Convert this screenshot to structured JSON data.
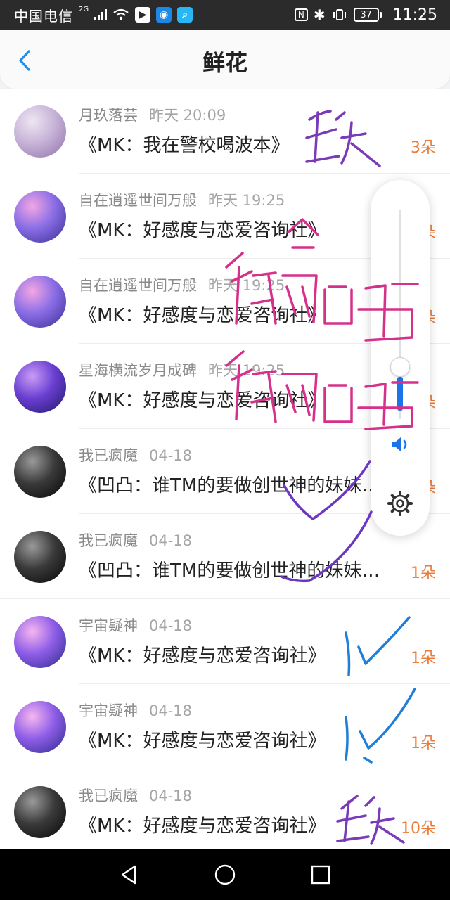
{
  "status_bar": {
    "carrier": "中国电信",
    "network": "2G",
    "battery": "37",
    "time": "11:25"
  },
  "header": {
    "title": "鲜花"
  },
  "rows": [
    {
      "name": "月玖落芸",
      "time": "昨天 20:09",
      "message": "《MK：我在警校喝波本》",
      "count": "3朵",
      "avatar_colors": [
        "#efe6f3",
        "#c7b4d8",
        "#8f6fa8"
      ]
    },
    {
      "name": "自在逍遥世间万般",
      "time": "昨天 19:25",
      "message": "《MK：好感度与恋爱咨询社》",
      "count": "3朵",
      "avatar_colors": [
        "#f3a6e3",
        "#8a6ee6",
        "#3a2d91"
      ]
    },
    {
      "name": "自在逍遥世间万般",
      "time": "昨天 19:25",
      "message": "《MK：好感度与恋爱咨询社》",
      "count": "3朵",
      "avatar_colors": [
        "#f3a6e3",
        "#8a6ee6",
        "#3a2d91"
      ]
    },
    {
      "name": "星海横流岁月成碑",
      "time": "昨天 19:25",
      "message": "《MK：好感度与恋爱咨询社》",
      "count": "3朵",
      "avatar_colors": [
        "#c99cf7",
        "#6a3fd1",
        "#1f1766"
      ]
    },
    {
      "name": "我已疯魔",
      "time": "04-18",
      "message": "《凹凸：谁TM的要做创世神的妹妹…",
      "count": "1朵",
      "avatar_colors": [
        "#9a9a9a",
        "#3a3a3a",
        "#050505"
      ]
    },
    {
      "name": "我已疯魔",
      "time": "04-18",
      "message": "《凹凸：谁TM的要做创世神的妹妹…",
      "count": "1朵",
      "avatar_colors": [
        "#9a9a9a",
        "#3a3a3a",
        "#050505"
      ]
    },
    {
      "name": "宇宙疑神",
      "time": "04-18",
      "message": "《MK：好感度与恋爱咨询社》",
      "count": "1朵",
      "avatar_colors": [
        "#f6b6ef",
        "#8f5ee8",
        "#2a2a8a"
      ]
    },
    {
      "name": "宇宙疑神",
      "time": "04-18",
      "message": "《MK：好感度与恋爱咨询社》",
      "count": "1朵",
      "avatar_colors": [
        "#f6b6ef",
        "#8f5ee8",
        "#2a2a8a"
      ]
    },
    {
      "name": "我已疯魔",
      "time": "04-18",
      "message": "《MK：好感度与恋爱咨询社》",
      "count": "10朵",
      "avatar_colors": [
        "#9a9a9a",
        "#3a3a3a",
        "#050505"
      ]
    }
  ],
  "colors": {
    "accent": "#1a73e8",
    "count": "#e97c3a",
    "ink_purple": "#7a3bb8",
    "ink_pink": "#d6308a",
    "ink_blue": "#1f7fd8"
  }
}
